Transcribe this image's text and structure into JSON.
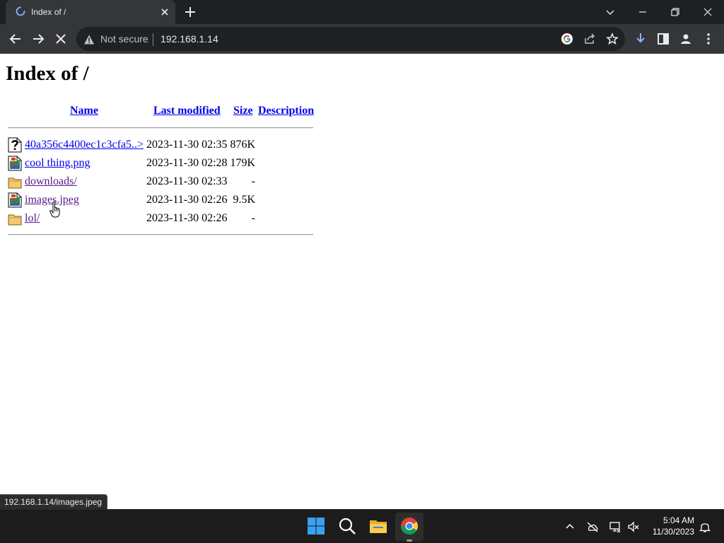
{
  "browser": {
    "tab": {
      "title": "Index of /"
    },
    "address_bar": {
      "security_label": "Not secure",
      "url": "192.168.1.14"
    },
    "status_url": "192.168.1.14/images.jpeg"
  },
  "page": {
    "title": "Index of /",
    "columns": {
      "name": "Name",
      "last_modified": "Last modified",
      "size": "Size",
      "description": "Description"
    },
    "rows": [
      {
        "name": "40a356c4400ec1c3cfa5..>",
        "modified": "2023-11-30 02:35",
        "size": "876K",
        "icon": "unknown-file-icon"
      },
      {
        "name": "cool thing.png",
        "modified": "2023-11-30 02:28",
        "size": "179K",
        "icon": "image-file-icon"
      },
      {
        "name": "downloads/",
        "modified": "2023-11-30 02:33",
        "size": "-",
        "icon": "folder-icon"
      },
      {
        "name": "images.jpeg",
        "modified": "2023-11-30 02:26",
        "size": "9.5K",
        "icon": "image-file-icon"
      },
      {
        "name": "lol/",
        "modified": "2023-11-30 02:26",
        "size": "-",
        "icon": "folder-icon"
      }
    ]
  },
  "taskbar": {
    "time": "5:04 AM",
    "date": "11/30/2023"
  },
  "colors": {
    "link": "#0000ee",
    "visited_link": "#551a8b",
    "chrome_frame": "#202124",
    "toolbar": "#35363a",
    "taskbar": "#1c1c1c"
  }
}
